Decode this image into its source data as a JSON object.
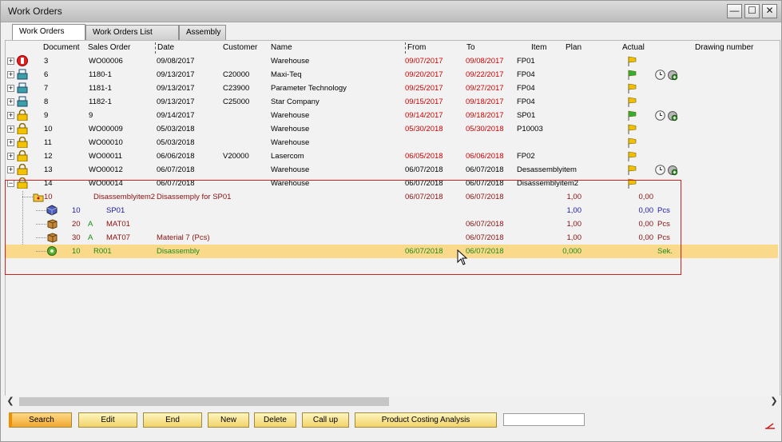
{
  "window": {
    "title": "Work Orders",
    "minimize": "—",
    "maximize": "☐",
    "close": "✕"
  },
  "tabs": [
    {
      "label": "Work Orders",
      "active": true
    },
    {
      "label": "Work Orders List",
      "active": false
    },
    {
      "label": "Assembly",
      "active": false
    }
  ],
  "columns": {
    "document": "Document",
    "sales_order": "Sales Order",
    "date": "Date",
    "customer": "Customer",
    "name": "Name",
    "from": "From",
    "to": "To",
    "item": "Item",
    "plan": "Plan",
    "actual": "Actual",
    "drawing_number": "Drawing number"
  },
  "rows": [
    {
      "doc": "3",
      "so": "WO00006",
      "date": "09/08/2017",
      "customer": "",
      "name": "Warehouse",
      "from": "09/07/2017",
      "to": "09/08/2017",
      "item": "FP01",
      "icon": "stop-icon",
      "flag": "yellow-flag-icon",
      "late": true,
      "extras": false
    },
    {
      "doc": "6",
      "so": "1180-1",
      "date": "09/13/2017",
      "customer": "C20000",
      "name": "Maxi-Teq",
      "from": "09/20/2017",
      "to": "09/22/2017",
      "item": "FP04",
      "icon": "printer-icon",
      "flag": "green-flag-icon",
      "late": true,
      "extras": true
    },
    {
      "doc": "7",
      "so": "1181-1",
      "date": "09/13/2017",
      "customer": "C23900",
      "name": "Parameter Technology",
      "from": "09/25/2017",
      "to": "09/27/2017",
      "item": "FP04",
      "icon": "printer-icon",
      "flag": "yellow-flag-icon",
      "late": true,
      "extras": false
    },
    {
      "doc": "8",
      "so": "1182-1",
      "date": "09/13/2017",
      "customer": "C25000",
      "name": "Star Company",
      "from": "09/15/2017",
      "to": "09/18/2017",
      "item": "FP04",
      "icon": "printer-icon",
      "flag": "yellow-flag-icon",
      "late": true,
      "extras": false
    },
    {
      "doc": "9",
      "so": "9",
      "date": "09/14/2017",
      "customer": "",
      "name": "Warehouse",
      "from": "09/14/2017",
      "to": "09/18/2017",
      "item": "SP01",
      "icon": "lock-icon",
      "flag": "green-flag-icon",
      "late": true,
      "extras": true
    },
    {
      "doc": "10",
      "so": "WO00009",
      "date": "05/03/2018",
      "customer": "",
      "name": "Warehouse",
      "from": "05/30/2018",
      "to": "05/30/2018",
      "item": "P10003",
      "icon": "lock-icon",
      "flag": "yellow-flag-icon",
      "late": true,
      "extras": false
    },
    {
      "doc": "11",
      "so": "WO00010",
      "date": "05/03/2018",
      "customer": "",
      "name": "Warehouse",
      "from": "",
      "to": "",
      "item": "",
      "icon": "lock-icon",
      "flag": "yellow-flag-icon",
      "late": false,
      "extras": false
    },
    {
      "doc": "12",
      "so": "WO00011",
      "date": "06/06/2018",
      "customer": "V20000",
      "name": "Lasercom",
      "from": "06/05/2018",
      "to": "06/06/2018",
      "item": "FP02",
      "icon": "lock-icon",
      "flag": "yellow-flag-icon",
      "late": true,
      "extras": false
    },
    {
      "doc": "13",
      "so": "WO00012",
      "date": "06/07/2018",
      "customer": "",
      "name": "Warehouse",
      "from": "06/07/2018",
      "to": "06/07/2018",
      "item": "Desassemblyitem",
      "icon": "lock-icon",
      "flag": "yellow-flag-icon",
      "late": false,
      "extras": true
    },
    {
      "doc": "14",
      "so": "WO00014",
      "date": "06/07/2018",
      "customer": "",
      "name": "Warehouse",
      "from": "06/07/2018",
      "to": "06/07/2018",
      "item": "Disassemblyitem2",
      "icon": "lock-icon",
      "flag": "yellow-flag-icon",
      "late": false,
      "extras": false,
      "expanded": true
    }
  ],
  "subrows": [
    {
      "pos": "10",
      "code": "Disassemblyitem2",
      "desc": "Disassemply for SP01",
      "marker": "",
      "from": "06/07/2018",
      "to": "06/07/2018",
      "plan": "1,00",
      "actual": "0,00",
      "unit": "",
      "color": "dred",
      "icon": "folder-icon"
    },
    {
      "pos": "10",
      "code": "SP01",
      "desc": "",
      "marker": "",
      "from": "",
      "to": "",
      "plan": "1,00",
      "actual": "0,00",
      "unit": "Pcs",
      "color": "blue",
      "icon": "cube-icon"
    },
    {
      "pos": "20",
      "code": "MAT01",
      "desc": "",
      "marker": "A",
      "from": "",
      "to": "06/07/2018",
      "plan": "1,00",
      "actual": "0,00",
      "unit": "Pcs",
      "color": "dred",
      "icon": "box-icon"
    },
    {
      "pos": "30",
      "code": "MAT07",
      "desc": "Material 7 (Pcs)",
      "marker": "A",
      "from": "",
      "to": "06/07/2018",
      "plan": "1,00",
      "actual": "0,00",
      "unit": "Pcs",
      "color": "dred",
      "icon": "box-icon"
    },
    {
      "pos": "10",
      "code": "R001",
      "desc": "Disassembly",
      "marker": "",
      "from": "06/07/2018",
      "to": "06/07/2018",
      "plan": "0,000",
      "actual": "",
      "unit": "Sek.",
      "color": "green",
      "icon": "gear-icon",
      "selected": true
    }
  ],
  "buttons": {
    "search": "Search",
    "edit": "Edit",
    "end": "End",
    "new": "New",
    "delete": "Delete",
    "call_up": "Call up",
    "product_costing": "Product Costing Analysis"
  },
  "colors": {
    "late": "#d00000",
    "selected_row": "#fbd98a",
    "highlight_box": "#d02020"
  }
}
